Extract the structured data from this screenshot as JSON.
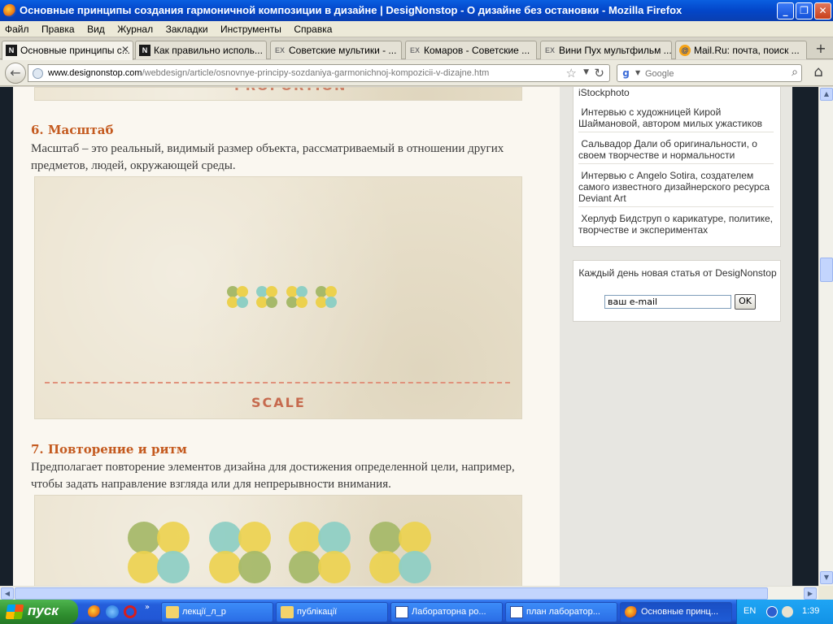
{
  "window": {
    "title": "Основные принципы создания гармоничной композиции в дизайне  | DesigNonstop - О дизайне без остановки - Mozilla Firefox",
    "minimize": "_",
    "maximize": "❐",
    "close": "✕"
  },
  "menu": [
    "Файл",
    "Правка",
    "Вид",
    "Журнал",
    "Закладки",
    "Инструменты",
    "Справка"
  ],
  "tabs": [
    {
      "label": "Основные принципы с...",
      "favicon": "N",
      "active": true
    },
    {
      "label": "Как правильно исполь...",
      "favicon": "N",
      "active": false
    },
    {
      "label": "Советские мультики - ...",
      "favicon": "EX",
      "active": false
    },
    {
      "label": "Комаров - Советские ...",
      "favicon": "EX",
      "active": false
    },
    {
      "label": "Вини Пух мультфильм ...",
      "favicon": "EX",
      "active": false
    },
    {
      "label": "Mail.Ru: почта, поиск ...",
      "favicon": "@",
      "active": false
    }
  ],
  "nav": {
    "url_host": "www.designonstop.com",
    "url_path": "/webdesign/article/osnovnye-principy-sozdaniya-garmonichnoj-kompozicii-v-dizajne.htm",
    "search_placeholder": "Google"
  },
  "article": {
    "top_caption": "PROPORTION",
    "sections": [
      {
        "title": "6. Масштаб",
        "text": "Масштаб – это реальный, видимый размер объекта, рассматриваемый в отношении других предметов, людей, окружающей среды.",
        "image_caption": "SCALE"
      },
      {
        "title": "7. Повторение и ритм",
        "text": "Предполагает повторение элементов дизайна для достижения определенной цели, например, чтобы задать направление взгляда или для непрерывности внимания."
      }
    ]
  },
  "sidebar": {
    "partial_item": "iStockphoto",
    "links": [
      "Интервью с художницей Кирой Шаймановой, автором милых ужастиков",
      "Сальвадор Дали об оригинальности, о своем творчестве и нормальности",
      "Интервью с Angelo Sotira, создателем самого известного дизайнерского ресурса Deviant Art",
      "Херлуф Бидструп о карикатуре, политике, творчестве и экспериментах"
    ],
    "subscribe": {
      "text": "Каждый день новая статья от DesigNonstop",
      "email_value": "ваш e-mail",
      "ok_label": "OK"
    }
  },
  "taskbar": {
    "start_label": "пуск",
    "buttons": [
      {
        "label": "лекції_л_р",
        "icon": "folder-icon"
      },
      {
        "label": "публікації",
        "icon": "folder-icon"
      },
      {
        "label": "Лабораторна ро...",
        "icon": "word-icon"
      },
      {
        "label": "план лаборатор...",
        "icon": "word-icon"
      },
      {
        "label": "Основные принц...",
        "icon": "firefox-icon",
        "active": true
      }
    ],
    "lang": "EN",
    "clock": "1:39"
  },
  "colors": {
    "section_title": "#c45a1f",
    "green": "#a6b96a",
    "teal": "#8fcfc4",
    "yellow": "#ecd14e",
    "caption": "#c66a4e"
  }
}
